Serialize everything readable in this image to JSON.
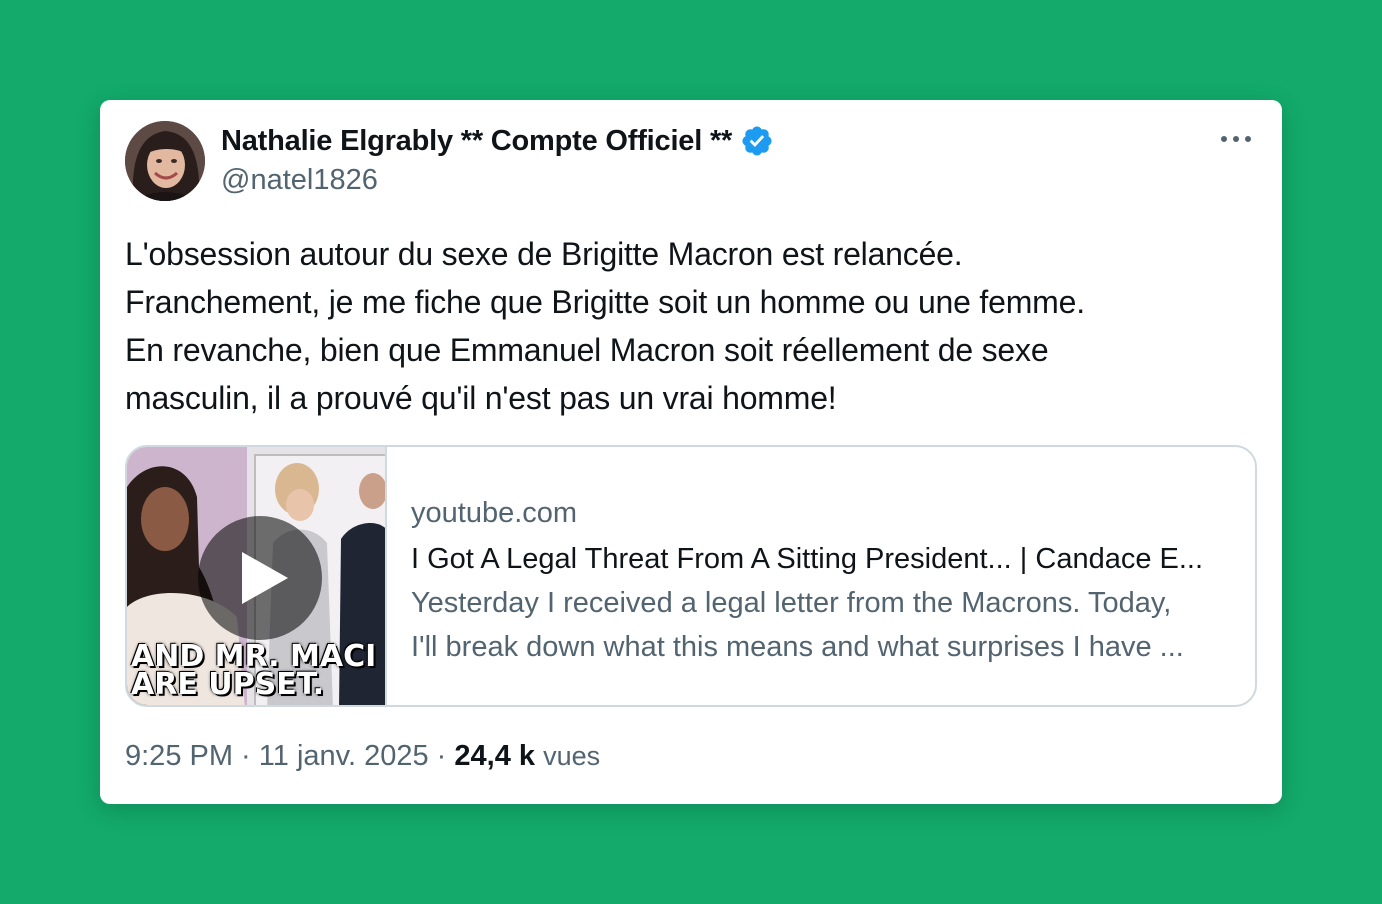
{
  "author": {
    "name": "Nathalie Elgrably ** Compte Officiel **",
    "handle": "@natel1826",
    "verified": true
  },
  "tweet": {
    "lines": [
      "L'obsession autour du sexe de Brigitte Macron est relancée.",
      "Franchement, je me fiche que Brigitte soit un homme ou une femme.",
      "En revanche, bien que Emmanuel Macron soit réellement de sexe",
      "masculin, il a prouvé qu'il n'est pas un vrai homme!"
    ]
  },
  "link_card": {
    "domain": "youtube.com",
    "title": "I Got A Legal Threat From A Sitting President... | Candace E...",
    "description_lines": [
      "Yesterday I received a legal letter from the Macrons. Today,",
      "I'll break down what this means and what surprises I have ..."
    ],
    "thumbnail_caption": "AND MR. MACI\n  ARE UPSET."
  },
  "footer": {
    "time": "9:25 PM",
    "separator": " · ",
    "date": "11 janv. 2025",
    "views_count": "24,4 k",
    "views_label": "vues"
  },
  "colors": {
    "background": "#13aa6b",
    "verified_badge": "#1d9bf0",
    "text_primary": "#0f1419",
    "text_secondary": "#536471"
  },
  "icons": {
    "verified": "verified-badge-icon",
    "more": "more-options-icon",
    "play": "play-icon"
  }
}
